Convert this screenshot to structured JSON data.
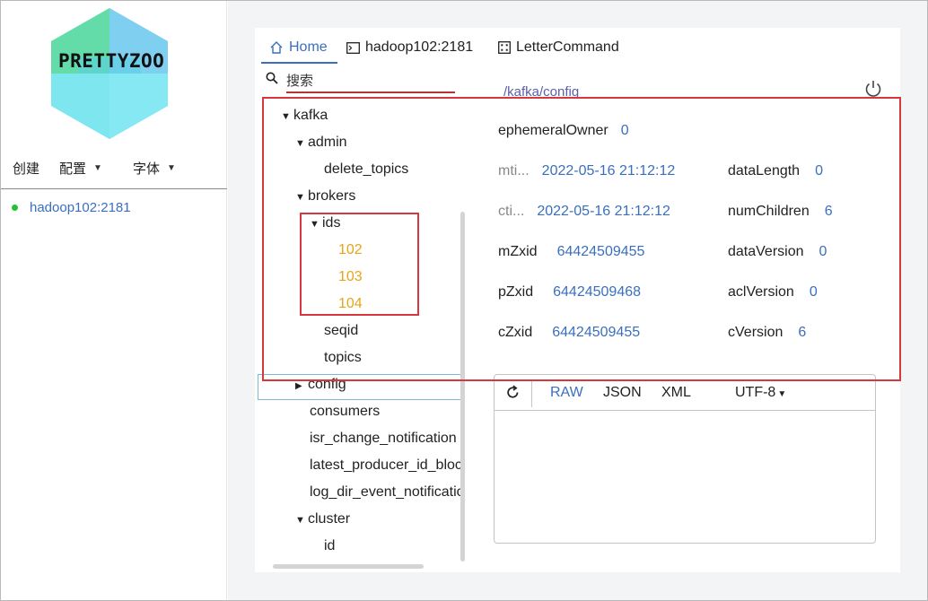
{
  "app": {
    "logo_text": "PRETTYZOO",
    "colors": {
      "accent": "#3a6fbf",
      "highlight": "#d6383e",
      "leaf": "#e8a317",
      "online": "#25c22e"
    }
  },
  "sidebar": {
    "menu": [
      {
        "label": "创建"
      },
      {
        "label": "配置"
      },
      {
        "label": "字体"
      }
    ],
    "servers": [
      {
        "label": "hadoop102:2181",
        "status": "online"
      }
    ]
  },
  "tabs": [
    {
      "label": "Home",
      "icon": "home-icon"
    },
    {
      "label": "hadoop102:2181",
      "icon": "terminal-icon"
    },
    {
      "label": "LetterCommand",
      "icon": "grid-icon"
    }
  ],
  "search": {
    "placeholder": "搜索"
  },
  "tree": [
    {
      "label": "kafka",
      "expanded": true
    },
    {
      "label": "admin",
      "expanded": true
    },
    {
      "label": "delete_topics"
    },
    {
      "label": "brokers",
      "expanded": true
    },
    {
      "label": "ids",
      "expanded": true
    },
    {
      "label": "102"
    },
    {
      "label": "103"
    },
    {
      "label": "104"
    },
    {
      "label": "seqid"
    },
    {
      "label": "topics"
    },
    {
      "label": "config",
      "expanded": false
    },
    {
      "label": "consumers"
    },
    {
      "label": "isr_change_notification"
    },
    {
      "label": "latest_producer_id_block"
    },
    {
      "label": "log_dir_event_notification"
    },
    {
      "label": "cluster",
      "expanded": true
    },
    {
      "label": "id"
    }
  ],
  "node": {
    "path": "/kafka/config",
    "stats": {
      "ephemeralOwner": {
        "label": "ephemeralOwner",
        "value": "0"
      },
      "mtime": {
        "label": "mti...",
        "value": "2022-05-16 21:12:12"
      },
      "ctime": {
        "label": "cti...",
        "value": "2022-05-16 21:12:12"
      },
      "mZxid": {
        "label": "mZxid",
        "value": "64424509455"
      },
      "pZxid": {
        "label": "pZxid",
        "value": "64424509468"
      },
      "cZxid": {
        "label": "cZxid",
        "value": "64424509455"
      },
      "dataLength": {
        "label": "dataLength",
        "value": "0"
      },
      "numChildren": {
        "label": "numChildren",
        "value": "6"
      },
      "dataVersion": {
        "label": "dataVersion",
        "value": "0"
      },
      "aclVersion": {
        "label": "aclVersion",
        "value": "0"
      },
      "cVersion": {
        "label": "cVersion",
        "value": "6"
      }
    }
  },
  "editor": {
    "formats": [
      {
        "label": "RAW"
      },
      {
        "label": "JSON"
      },
      {
        "label": "XML"
      }
    ],
    "encoding": "UTF-8"
  }
}
